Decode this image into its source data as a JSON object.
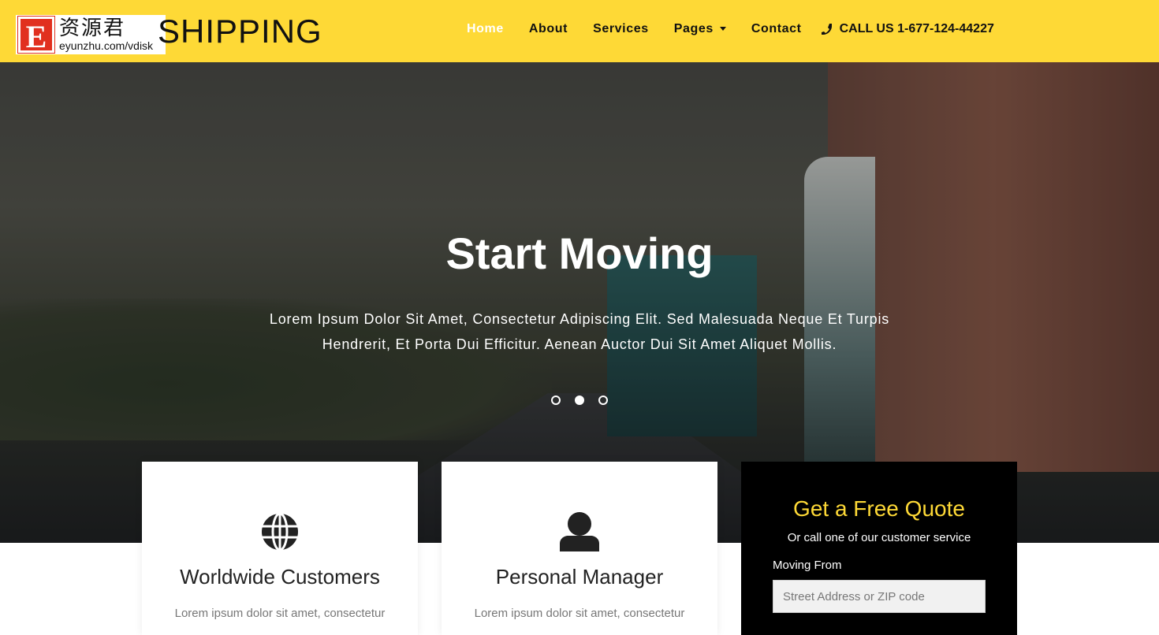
{
  "header": {
    "logo_text": "资源君",
    "logo_url": "eyunzhu.com/vdisk",
    "logo_letter": "E",
    "brand": "SHIPPING",
    "nav": [
      {
        "label": "Home",
        "active": true
      },
      {
        "label": "About"
      },
      {
        "label": "Services"
      },
      {
        "label": "Pages",
        "dropdown": true
      },
      {
        "label": "Contact"
      }
    ],
    "call": "CALL US 1-677-124-44227",
    "accent": "#fed936"
  },
  "hero": {
    "title": "Start Moving",
    "subtitle": "Lorem Ipsum Dolor Sit Amet, Consectetur Adipiscing Elit. Sed Malesuada Neque Et Turpis Hendrerit, Et Porta Dui Efficitur. Aenean Auctor Dui Sit Amet Aliquet Mollis.",
    "slides": 3,
    "active_slide": 2
  },
  "cards": [
    {
      "icon": "globe-icon",
      "title": "Worldwide Customers",
      "text": "Lorem ipsum dolor sit amet, consectetur"
    },
    {
      "icon": "user-icon",
      "title": "Personal Manager",
      "text": "Lorem ipsum dolor sit amet, consectetur"
    }
  ],
  "quote": {
    "title": "Get a Free Quote",
    "subtitle": "Or call one of our customer service",
    "from_label": "Moving From",
    "from_placeholder": "Street Address or ZIP code",
    "from_value": ""
  }
}
